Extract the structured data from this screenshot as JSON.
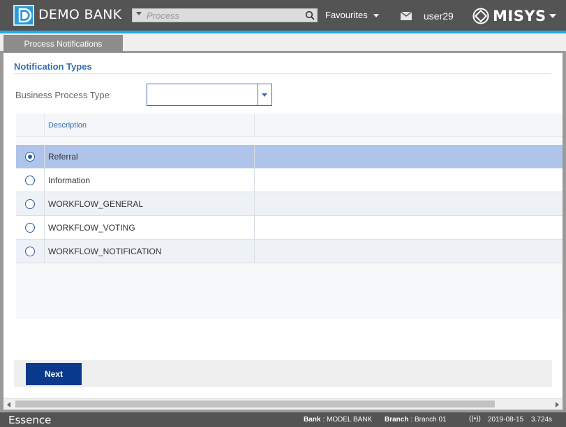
{
  "header": {
    "brand": "DEMO BANK",
    "search_placeholder": "Process",
    "favourites_label": "Favourites",
    "username": "user29",
    "vendor_logo_text": "MISYS",
    "colors": {
      "header_bg": "#545454",
      "accent_strip": "#1eaee6"
    }
  },
  "tabs": [
    {
      "label": "Process Notifications",
      "active": true
    }
  ],
  "form": {
    "section_title": "Notification Types",
    "business_process_type": {
      "label": "Business Process Type",
      "value": ""
    }
  },
  "grid": {
    "columns": [
      "",
      "Description",
      ""
    ],
    "rows": [
      {
        "description": "Referral",
        "selected": true
      },
      {
        "description": "Information",
        "selected": false
      },
      {
        "description": "WORKFLOW_GENERAL",
        "selected": false
      },
      {
        "description": "WORKFLOW_VOTING",
        "selected": false
      },
      {
        "description": "WORKFLOW_NOTIFICATION",
        "selected": false
      }
    ],
    "colors": {
      "selected_row": "#aec4ea",
      "alt_row": "#eef1f6"
    }
  },
  "actions": {
    "next_label": "Next",
    "next_color": "#0a3a8c"
  },
  "status_bar": {
    "app_name": "Essence",
    "bank_label": "Bank",
    "bank_value": "MODEL BANK",
    "branch_label": "Branch",
    "branch_value": "Branch 01",
    "connection_icon": "((•))",
    "date": "2019-08-15",
    "timing": "3.724s"
  }
}
